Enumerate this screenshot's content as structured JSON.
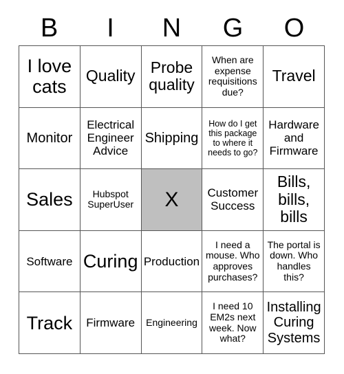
{
  "card": {
    "title_letters": [
      "B",
      "I",
      "N",
      "G",
      "O"
    ],
    "free_space": {
      "mark": "X",
      "fill_color": "#bfbfbf",
      "row": 2,
      "column": 2
    },
    "grid_border_color": "#555555",
    "background_color": "#ffffff",
    "text_color": "#000000",
    "rows": 5,
    "columns": 5,
    "cells": [
      [
        {
          "text": "I love cats",
          "size": "xxl",
          "marked": false
        },
        {
          "text": "Quality",
          "size": "xl",
          "marked": false
        },
        {
          "text": "Probe quality",
          "size": "xl",
          "marked": false
        },
        {
          "text": "When are expense requisitions due?",
          "size": "sm",
          "marked": false
        },
        {
          "text": "Travel",
          "size": "xl",
          "marked": false
        }
      ],
      [
        {
          "text": "Monitor",
          "size": "lg",
          "marked": false
        },
        {
          "text": "Electrical Engineer Advice",
          "size": "md",
          "marked": false
        },
        {
          "text": "Shipping",
          "size": "lg",
          "marked": false
        },
        {
          "text": "How do I get this package to where it needs to go?",
          "size": "xs",
          "marked": false
        },
        {
          "text": "Hardware and Firmware",
          "size": "md",
          "marked": false
        }
      ],
      [
        {
          "text": "Sales",
          "size": "xxl",
          "marked": false
        },
        {
          "text": "Hubspot SuperUser",
          "size": "sm",
          "marked": false
        },
        {
          "text": "X",
          "size": "free",
          "marked": true
        },
        {
          "text": "Customer Success",
          "size": "md",
          "marked": false
        },
        {
          "text": "Bills, bills, bills",
          "size": "xl",
          "marked": false
        }
      ],
      [
        {
          "text": "Software",
          "size": "md",
          "marked": false
        },
        {
          "text": "Curing",
          "size": "xxl",
          "marked": false
        },
        {
          "text": "Production",
          "size": "md",
          "marked": false
        },
        {
          "text": "I need a mouse. Who approves purchases?",
          "size": "sm",
          "marked": false
        },
        {
          "text": "The portal is down. Who handles this?",
          "size": "sm",
          "marked": false
        }
      ],
      [
        {
          "text": "Track",
          "size": "xxl",
          "marked": false
        },
        {
          "text": "Firmware",
          "size": "md",
          "marked": false
        },
        {
          "text": "Engineering",
          "size": "sm",
          "marked": false
        },
        {
          "text": "I need 10 EM2s next week. Now what?",
          "size": "sm",
          "marked": false
        },
        {
          "text": "Installing Curing Systems",
          "size": "lg",
          "marked": false
        }
      ]
    ]
  }
}
